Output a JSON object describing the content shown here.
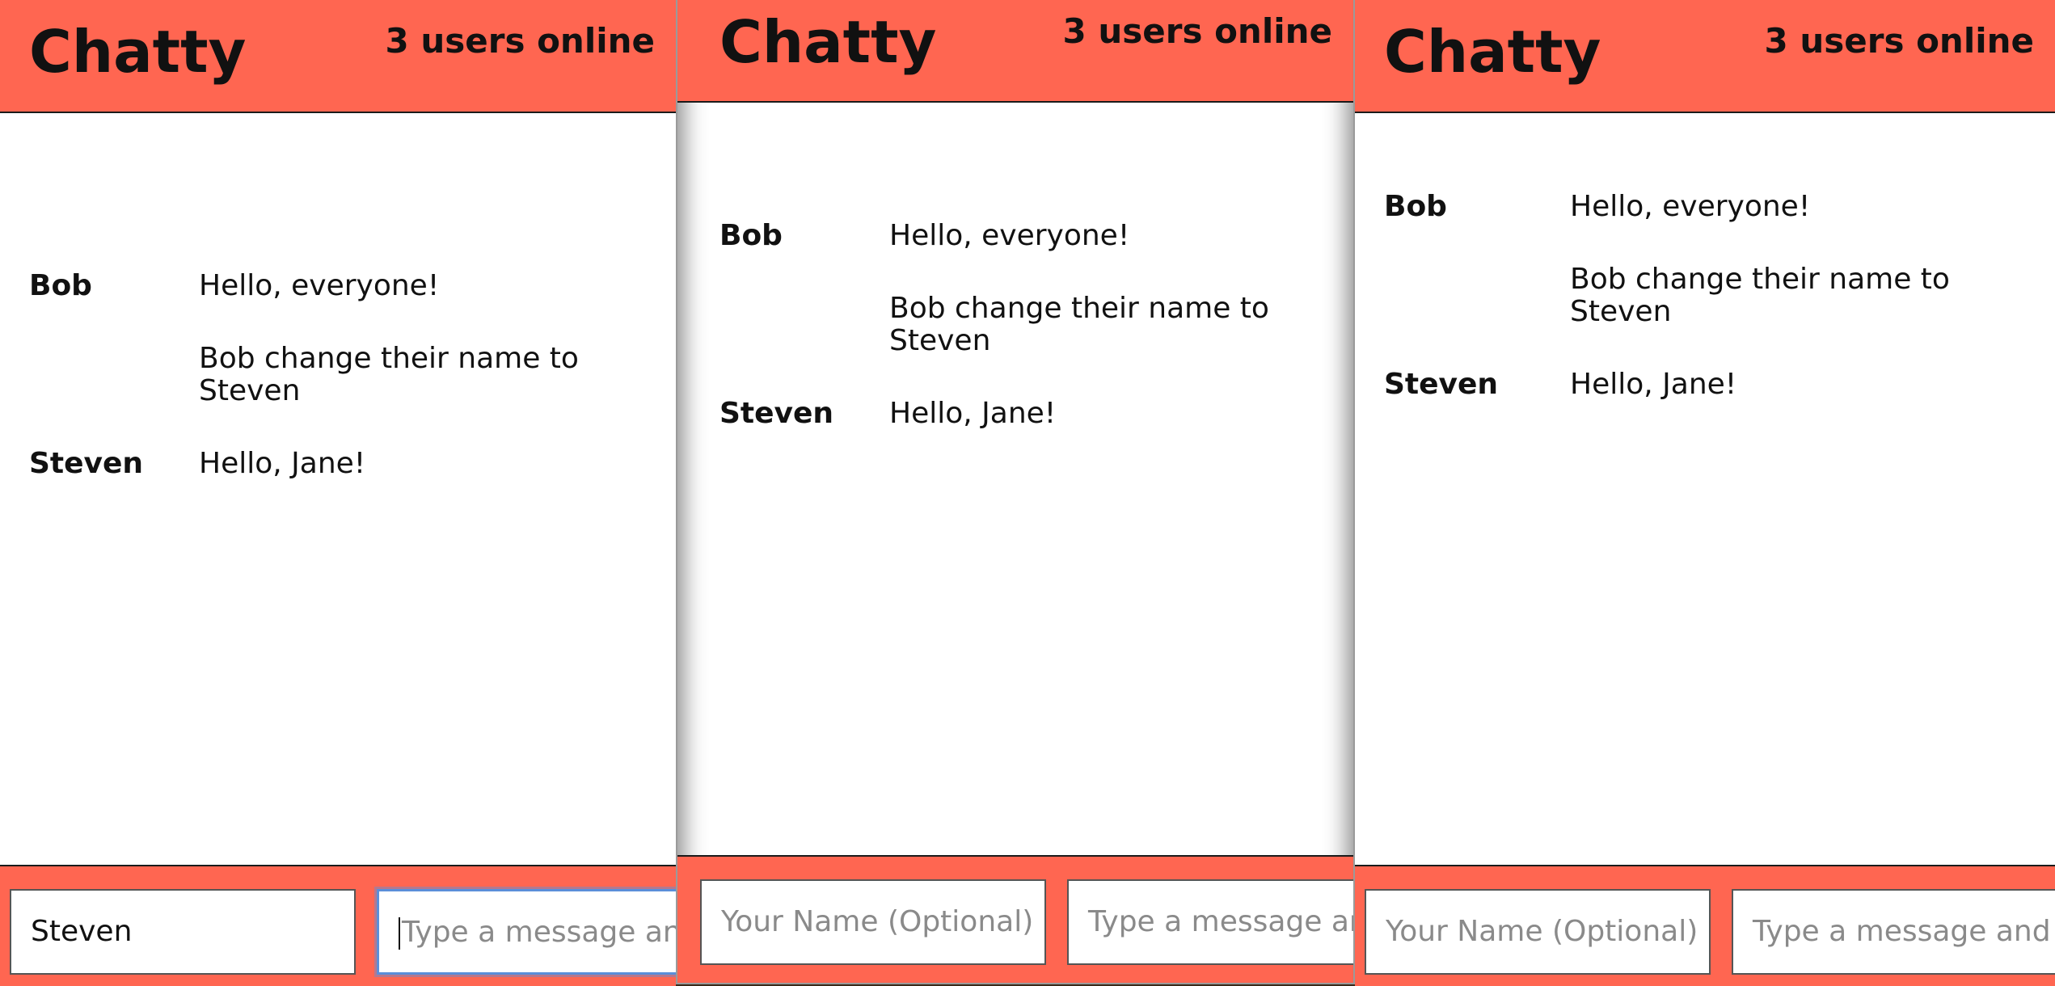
{
  "app": {
    "title": "Chatty",
    "online": "3 users online"
  },
  "windows": [
    {
      "messages": [
        {
          "user": "Bob",
          "content": "Hello, everyone!"
        },
        {
          "user": "",
          "content": "Bob change their name to Steven"
        },
        {
          "user": "Steven",
          "content": "Hello, Jane!"
        }
      ],
      "name_value": "Steven",
      "name_placeholder": "Your Name (Optional)",
      "message_placeholder": "Type a message and hit ENTER"
    },
    {
      "messages": [
        {
          "user": "Bob",
          "content": "Hello, everyone!"
        },
        {
          "user": "",
          "content": "Bob change their name to Steven"
        },
        {
          "user": "Steven",
          "content": "Hello, Jane!"
        }
      ],
      "name_value": "",
      "name_placeholder": "Your Name (Optional)",
      "message_placeholder": "Type a message and hit ENTER"
    },
    {
      "messages": [
        {
          "user": "Bob",
          "content": "Hello, everyone!"
        },
        {
          "user": "",
          "content": "Bob change their name to Steven"
        },
        {
          "user": "Steven",
          "content": "Hello, Jane!"
        }
      ],
      "name_value": "",
      "name_placeholder": "Your Name (Optional)",
      "message_placeholder": "Type a message and hit ENTER"
    }
  ],
  "colors": {
    "navbar": "#ff6651",
    "focus": "#5b8fd9"
  }
}
